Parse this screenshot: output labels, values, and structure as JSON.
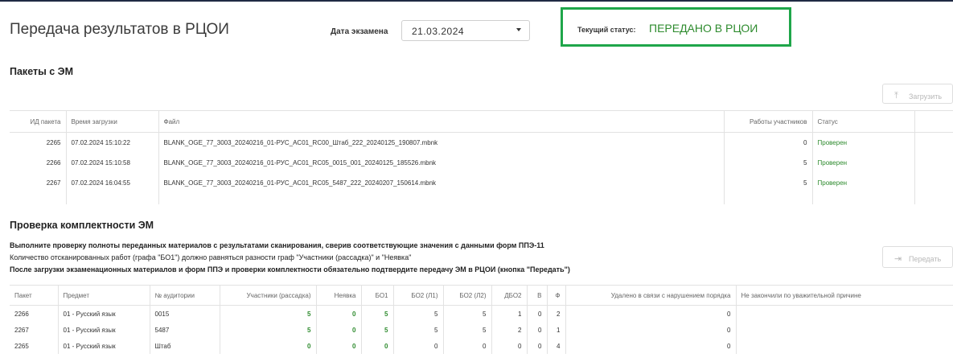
{
  "header": {
    "title": "Передача результатов в РЦОИ",
    "exam_date_label": "Дата экзамена",
    "exam_date_value": "21.03.2024",
    "status_label": "Текущий статус:",
    "status_value": "ПЕРЕДАНО В РЦОИ"
  },
  "packages": {
    "heading": "Пакеты с ЭМ",
    "upload_button": "Загрузить",
    "columns": [
      "ИД пакета",
      "Время загрузки",
      "Файл",
      "Работы участников",
      "Статус"
    ],
    "rows": [
      {
        "id": "2265",
        "time": "07.02.2024 15:10:22",
        "file": "BLANK_OGE_77_3003_20240216_01-РУС_AC01_RC00_Штаб_222_20240125_190807.mbnk",
        "works": "0",
        "status": "Проверен"
      },
      {
        "id": "2266",
        "time": "07.02.2024 15:10:58",
        "file": "BLANK_OGE_77_3003_20240216_01-РУС_AC01_RC05_0015_001_20240125_185526.mbnk",
        "works": "5",
        "status": "Проверен"
      },
      {
        "id": "2267",
        "time": "07.02.2024 16:04:55",
        "file": "BLANK_OGE_77_3003_20240216_01-РУС_AC01_RC05_5487_222_20240207_150614.mbnk",
        "works": "5",
        "status": "Проверен"
      }
    ]
  },
  "completeness": {
    "heading": "Проверка комплектности ЭМ",
    "note1": "Выполните проверку полноты переданных материалов с результатами сканирования, сверив соответствующие значения с данными форм ППЭ-11",
    "note2": "Количество отсканированных работ (графа \"БО1\") должно равняться разности граф \"Участники (рассадка)\" и \"Неявка\"",
    "note3": "После загрузки экзаменационных материалов и форм ППЭ и проверки комплектности обязательно подтвердите передачу ЭМ в РЦОИ (кнопка \"Передать\")",
    "transfer_button": "Передать",
    "columns": [
      "Пакет",
      "Предмет",
      "№ аудитории",
      "Участники (рассадка)",
      "Неявка",
      "БО1",
      "БО2 (Л1)",
      "БО2 (Л2)",
      "ДБО2",
      "В",
      "Ф",
      "Удалено в связи с нарушением порядка",
      "Не закончили по уважительной причине"
    ],
    "rows": [
      {
        "pkg": "2266",
        "subject": "01 - Русский язык",
        "room": "0015",
        "participants": "5",
        "absent": "0",
        "bo1": "5",
        "bo2l1": "5",
        "bo2l2": "5",
        "dbo2": "1",
        "v": "0",
        "f": "2",
        "removed": "0",
        "unfinished": ""
      },
      {
        "pkg": "2267",
        "subject": "01 - Русский язык",
        "room": "5487",
        "participants": "5",
        "absent": "0",
        "bo1": "5",
        "bo2l1": "5",
        "bo2l2": "5",
        "dbo2": "2",
        "v": "0",
        "f": "1",
        "removed": "0",
        "unfinished": ""
      },
      {
        "pkg": "2265",
        "subject": "01 - Русский язык",
        "room": "Штаб",
        "participants": "0",
        "absent": "0",
        "bo1": "0",
        "bo2l1": "0",
        "bo2l2": "0",
        "dbo2": "0",
        "v": "0",
        "f": "4",
        "removed": "0",
        "unfinished": ""
      }
    ]
  },
  "colors": {
    "status_green": "#2e8b2e",
    "status_border": "#1fa64a"
  }
}
